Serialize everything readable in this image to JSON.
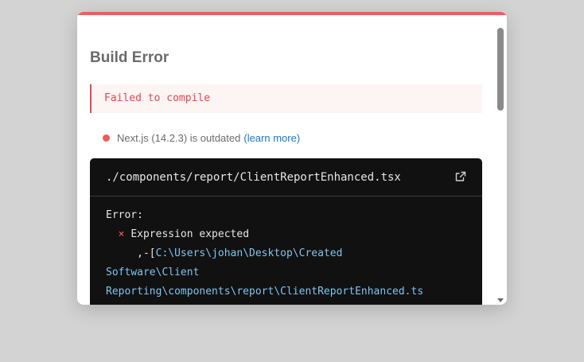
{
  "dialog": {
    "title": "Build Error",
    "error_banner": "Failed to compile",
    "version": {
      "text": "Next.js (14.2.3) is outdated",
      "link_label": "(learn more)",
      "dot_color": "#ef5a5a"
    },
    "code": {
      "file": "./components/report/ClientReportEnhanced.tsx",
      "open_icon": "external-link-icon",
      "lines": {
        "error_label": "Error:",
        "x_mark": "×",
        "message": "Expression expected",
        "path_prefix": ",-[",
        "path_part1": "C:\\Users\\johan\\Desktop\\Created",
        "path_part2": "Software\\Client",
        "path_part3": "Reporting\\components\\report\\ClientReportEnhanced.ts"
      }
    }
  },
  "colors": {
    "accent_bar": "#ed5e5e",
    "error_text": "#e5484d",
    "link": "#1e73d8",
    "code_bg": "#111111",
    "path_text": "#7fc4ee"
  }
}
